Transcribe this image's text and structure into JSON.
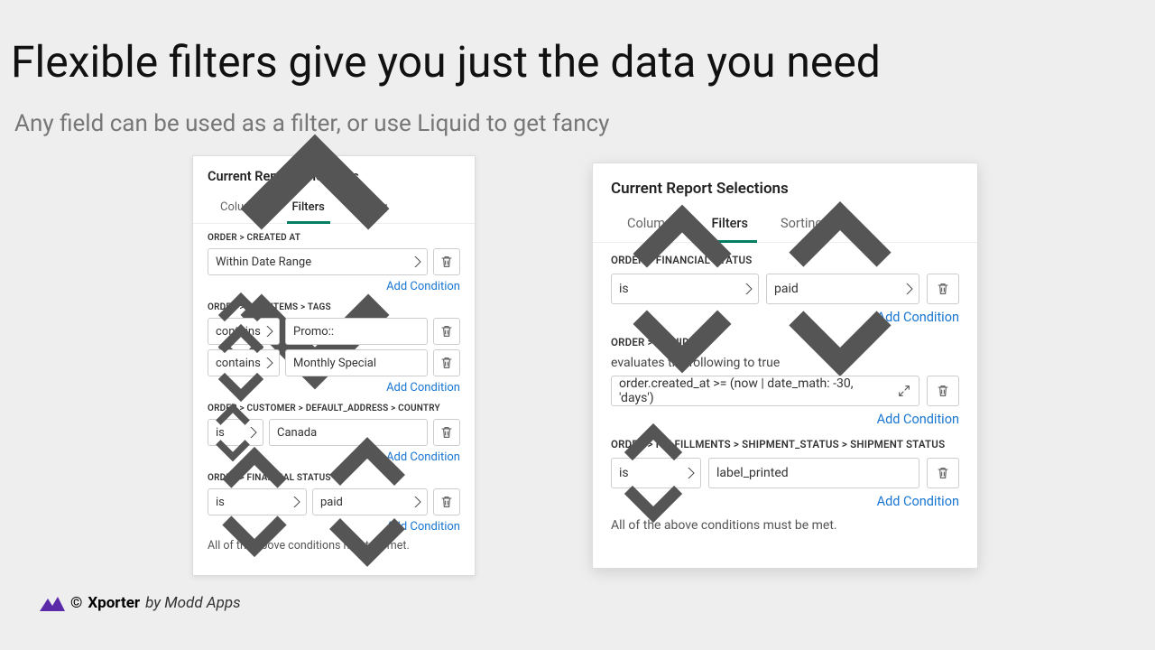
{
  "headline": "Flexible filters give you just the data you need",
  "subhead": "Any field can be used as a filter, or use Liquid to get fancy",
  "footer": {
    "copy": "©",
    "brand": "Xporter",
    "by": "by Modd Apps"
  },
  "shared": {
    "card_title": "Current Report Selections",
    "tabs": {
      "columns": "Columns",
      "filters": "Filters",
      "sorting": "Sorting"
    },
    "add_condition": "Add Condition",
    "footer_note": "All of the above conditions must be met."
  },
  "left": {
    "groups": {
      "created_at": {
        "label": "ORDER > CREATED AT",
        "rows": [
          {
            "select": "Within Date Range"
          }
        ]
      },
      "tags": {
        "label": "ORDER > LINE_ITEMS > TAGS",
        "rows": [
          {
            "op": "contains",
            "value": "Promo::"
          },
          {
            "op": "contains",
            "value": "Monthly Special"
          }
        ]
      },
      "country": {
        "label": "ORDER > CUSTOMER > DEFAULT_ADDRESS > COUNTRY",
        "rows": [
          {
            "op": "is",
            "value": "Canada"
          }
        ]
      },
      "financial": {
        "label": "ORDER > FINANCIAL STATUS",
        "rows": [
          {
            "op": "is",
            "value": "paid"
          }
        ]
      }
    }
  },
  "right": {
    "groups": {
      "financial": {
        "label": "ORDER > FINANCIAL STATUS",
        "rows": [
          {
            "op": "is",
            "value": "paid"
          }
        ]
      },
      "liquid": {
        "label": "ORDER > LIQUID",
        "helper": "evaluates the following to true",
        "rows": [
          {
            "value": "order.created_at >= (now | date_math: -30, 'days')"
          }
        ]
      },
      "shipment": {
        "label": "ORDER > FULFILLMENTS > SHIPMENT_STATUS > SHIPMENT STATUS",
        "rows": [
          {
            "op": "is",
            "value": "label_printed"
          }
        ]
      }
    }
  }
}
